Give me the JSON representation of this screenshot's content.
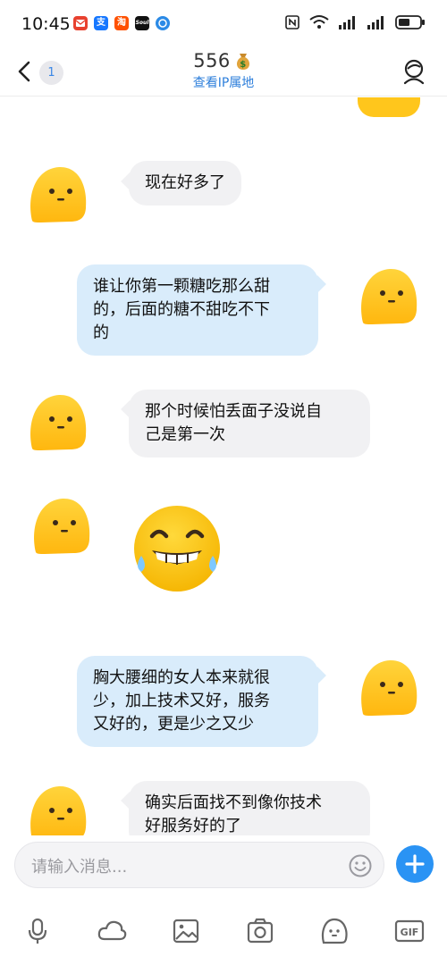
{
  "status_bar": {
    "time": "10:45",
    "app_icons": [
      {
        "name": "mail-app-icon",
        "color": "#e8412f",
        "glyph": ""
      },
      {
        "name": "alipay-app-icon",
        "color": "#1677ff",
        "glyph": "支"
      },
      {
        "name": "taobao-app-icon",
        "color": "#ff5000",
        "glyph": "淘"
      },
      {
        "name": "soul-app-icon",
        "color": "#111111",
        "glyph": "Soul"
      },
      {
        "name": "browser-app-icon",
        "color": "#2b8ae6",
        "glyph": ""
      }
    ],
    "battery_level": 0.55
  },
  "header": {
    "unread_count": "1",
    "title": "556",
    "subtitle": "查看IP属地"
  },
  "messages": [
    {
      "side": "left",
      "type": "text",
      "text": "现在好多了"
    },
    {
      "side": "right",
      "type": "text",
      "lines": [
        "谁让你第一颗糖吃那么甜",
        "的，后面的糖不甜吃不下",
        "的"
      ]
    },
    {
      "side": "left",
      "type": "text",
      "lines": [
        "那个时候怕丢面子没说自",
        "己是第一次"
      ]
    },
    {
      "side": "left",
      "type": "sticker",
      "sticker": "laughing-tears-sticker"
    },
    {
      "side": "right",
      "type": "text",
      "lines": [
        "胸大腰细的女人本来就很",
        "少，加上技术又好，服务",
        "又好的，更是少之又少"
      ]
    },
    {
      "side": "left",
      "type": "text",
      "lines": [
        "确实后面找不到像你技术",
        "好服务好的了"
      ]
    }
  ],
  "input": {
    "placeholder": "请输入消息..."
  },
  "toolbar": [
    "microphone-icon",
    "cloud-icon",
    "image-icon",
    "camera-icon",
    "emoji-face-icon",
    "gif-icon"
  ],
  "colors": {
    "accent": "#2a93f4",
    "link": "#2e7fdb",
    "right_bubble": "#d9ecfb",
    "left_bubble": "#f1f1f3",
    "avatar_yellow": "#ffc61c"
  }
}
